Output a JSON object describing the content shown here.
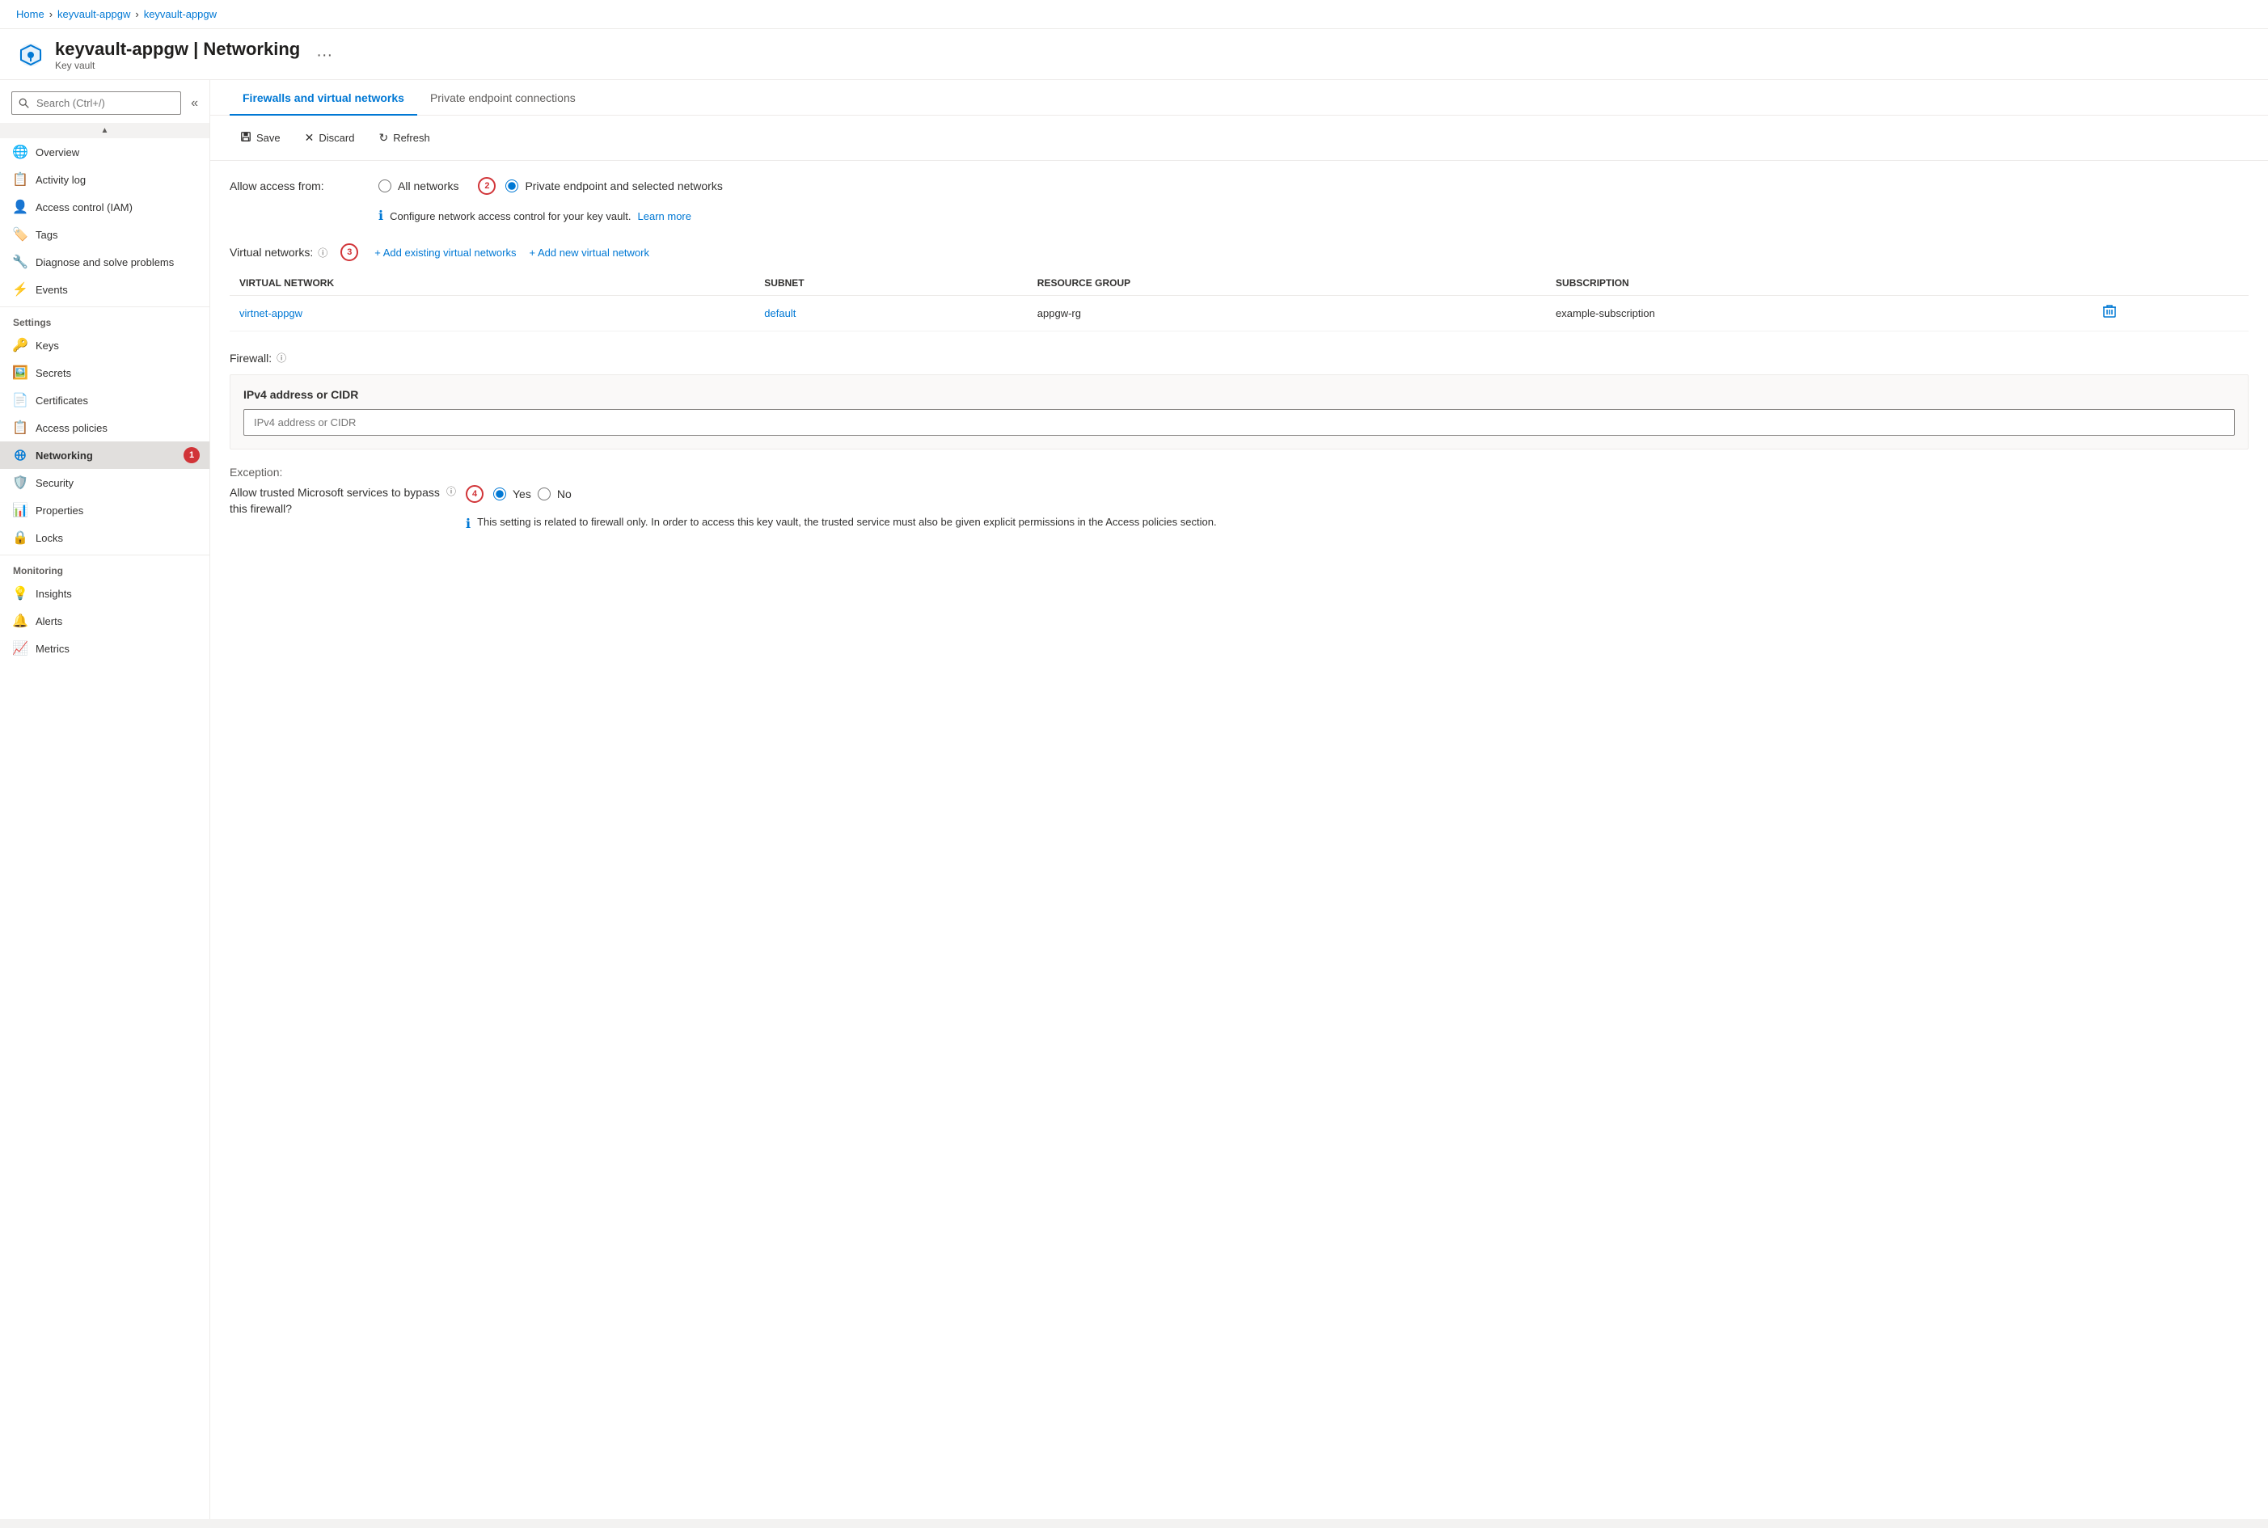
{
  "breadcrumb": {
    "home": "Home",
    "vault1": "keyvault-appgw",
    "vault2": "keyvault-appgw",
    "sep": ">"
  },
  "header": {
    "title": "keyvault-appgw | Networking",
    "subtitle": "Key vault",
    "more_label": "···"
  },
  "sidebar": {
    "search_placeholder": "Search (Ctrl+/)",
    "collapse_icon": "«",
    "items": [
      {
        "id": "overview",
        "label": "Overview",
        "icon": "🌐",
        "active": false
      },
      {
        "id": "activity-log",
        "label": "Activity log",
        "icon": "📋",
        "active": false
      },
      {
        "id": "access-control",
        "label": "Access control (IAM)",
        "icon": "👤",
        "active": false
      },
      {
        "id": "tags",
        "label": "Tags",
        "icon": "🏷️",
        "active": false
      },
      {
        "id": "diagnose",
        "label": "Diagnose and solve problems",
        "icon": "🔧",
        "active": false
      },
      {
        "id": "events",
        "label": "Events",
        "icon": "⚡",
        "active": false
      }
    ],
    "settings_section": "Settings",
    "settings_items": [
      {
        "id": "keys",
        "label": "Keys",
        "icon": "🔑"
      },
      {
        "id": "secrets",
        "label": "Secrets",
        "icon": "🖼️"
      },
      {
        "id": "certificates",
        "label": "Certificates",
        "icon": "📄"
      },
      {
        "id": "access-policies",
        "label": "Access policies",
        "icon": "📋"
      },
      {
        "id": "networking",
        "label": "Networking",
        "icon": "🔗",
        "active": true,
        "badge": "1"
      },
      {
        "id": "security",
        "label": "Security",
        "icon": "🛡️"
      },
      {
        "id": "properties",
        "label": "Properties",
        "icon": "📊"
      },
      {
        "id": "locks",
        "label": "Locks",
        "icon": "🔒"
      }
    ],
    "monitoring_section": "Monitoring",
    "monitoring_items": [
      {
        "id": "insights",
        "label": "Insights",
        "icon": "💡"
      },
      {
        "id": "alerts",
        "label": "Alerts",
        "icon": "🔔"
      },
      {
        "id": "metrics",
        "label": "Metrics",
        "icon": "📈"
      }
    ]
  },
  "tabs": [
    {
      "id": "firewalls",
      "label": "Firewalls and virtual networks",
      "active": true
    },
    {
      "id": "private-endpoints",
      "label": "Private endpoint connections",
      "active": false
    }
  ],
  "toolbar": {
    "save_label": "Save",
    "discard_label": "Discard",
    "refresh_label": "Refresh"
  },
  "access_from": {
    "label": "Allow access from:",
    "options": [
      {
        "id": "all-networks",
        "label": "All networks",
        "selected": false
      },
      {
        "id": "private-endpoint",
        "label": "Private endpoint and selected networks",
        "selected": true
      }
    ],
    "badge_number": "2",
    "info_text": "Configure network access control for your key vault.",
    "learn_more": "Learn more"
  },
  "virtual_networks": {
    "label": "Virtual networks:",
    "badge_number": "3",
    "add_existing": "+ Add existing virtual networks",
    "add_new": "+ Add new virtual network",
    "table_headers": [
      "VIRTUAL NETWORK",
      "SUBNET",
      "RESOURCE GROUP",
      "SUBSCRIPTION"
    ],
    "rows": [
      {
        "virtual_network": "virtnet-appgw",
        "subnet": "default",
        "resource_group": "appgw-rg",
        "subscription": "example-subscription"
      }
    ]
  },
  "firewall": {
    "label": "Firewall:",
    "ipv4_section_title": "IPv4 address or CIDR",
    "ipv4_placeholder": "IPv4 address or CIDR"
  },
  "exception": {
    "section_label": "Exception:",
    "question": "Allow trusted Microsoft services to bypass this firewall?",
    "badge_number": "4",
    "options": [
      {
        "id": "yes",
        "label": "Yes",
        "selected": true
      },
      {
        "id": "no",
        "label": "No",
        "selected": false
      }
    ],
    "info_text": "This setting is related to firewall only. In order to access this key vault, the trusted service must also be given explicit permissions in the Access policies section."
  }
}
